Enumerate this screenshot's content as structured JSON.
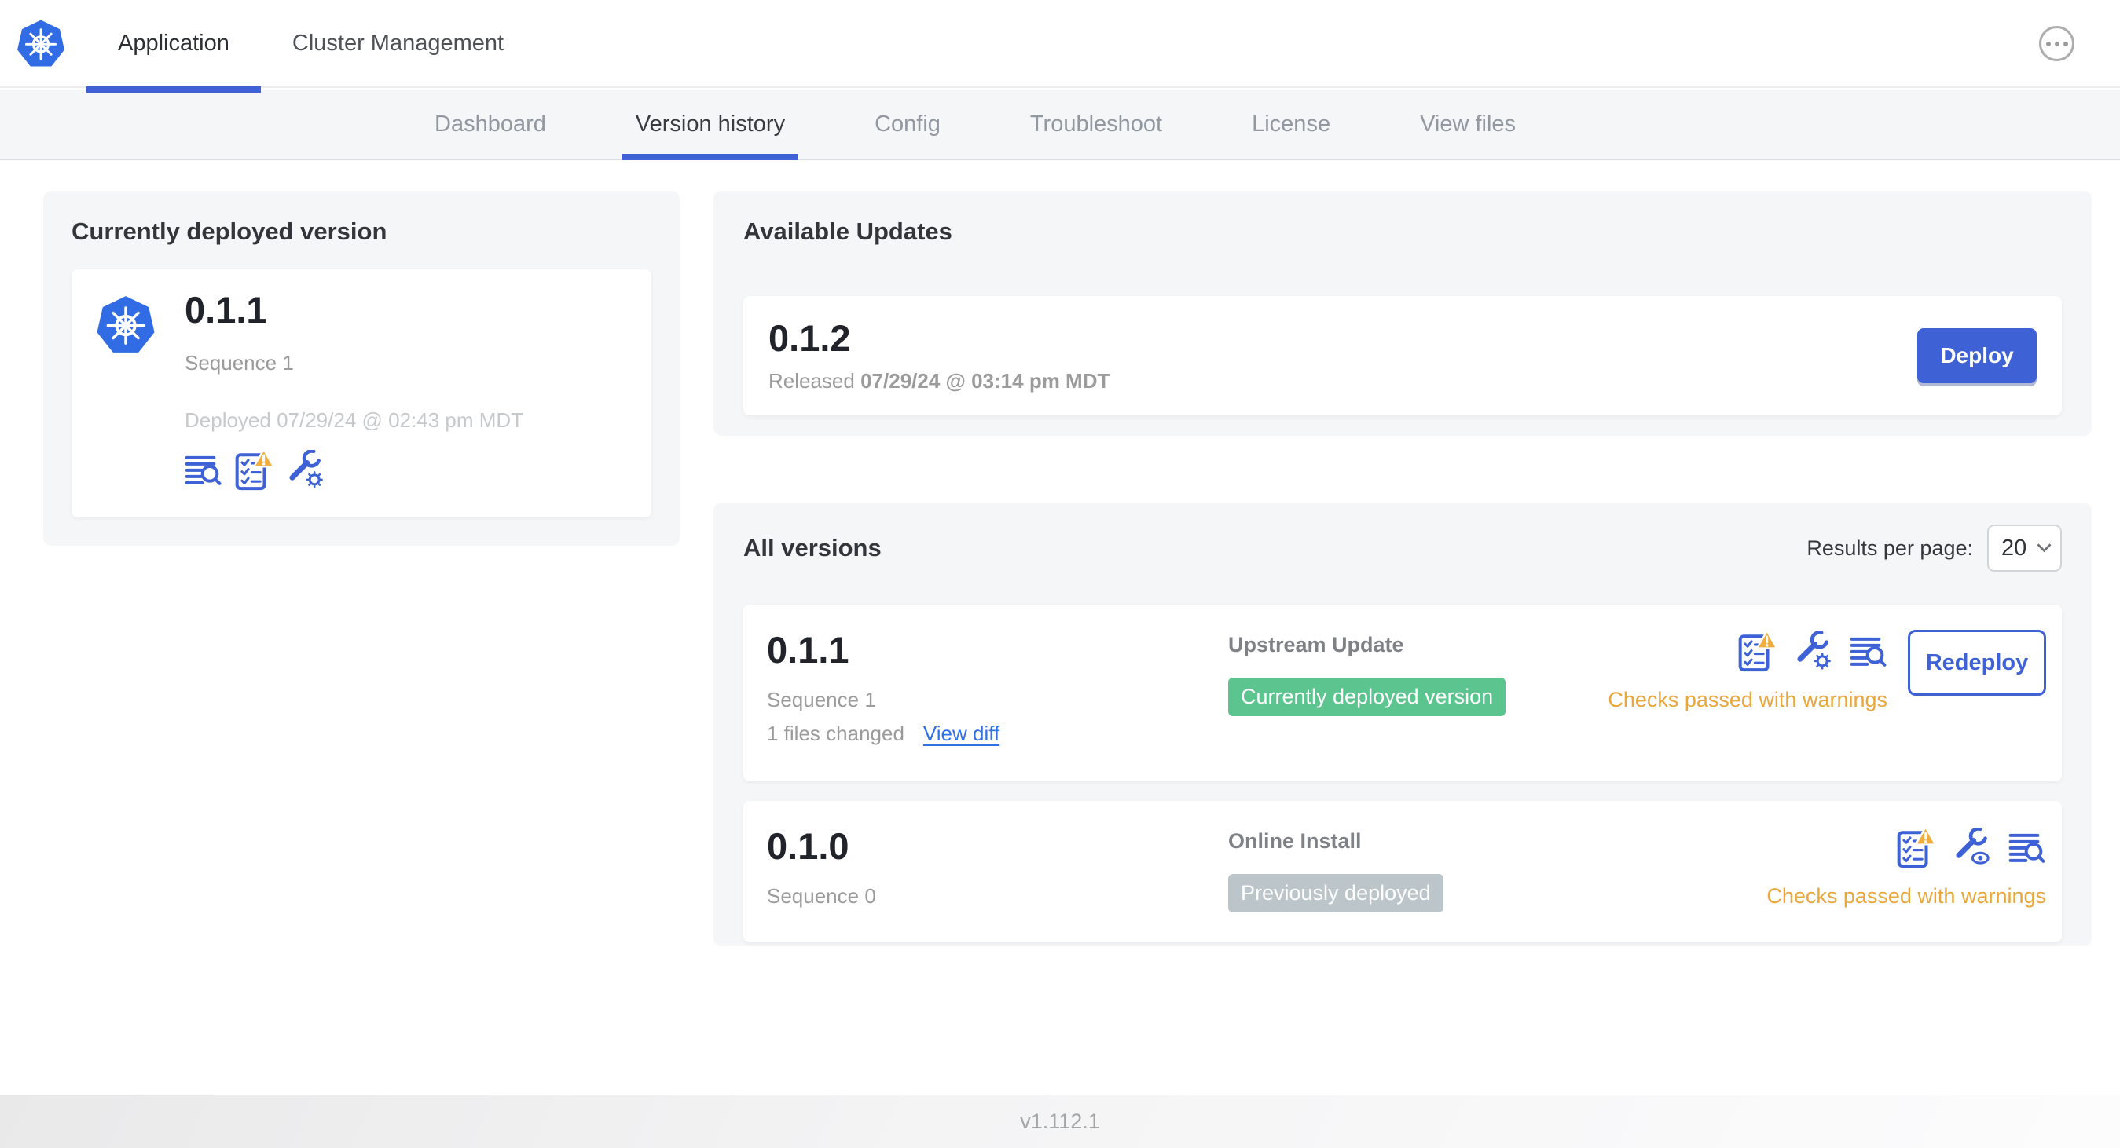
{
  "header": {
    "logo_icon": "kubernetes-logo",
    "tabs": [
      {
        "label": "Application",
        "active": true
      },
      {
        "label": "Cluster Management",
        "active": false
      }
    ],
    "menu_icon": "ellipsis-icon"
  },
  "subnav": {
    "tabs": [
      {
        "label": "Dashboard",
        "active": false
      },
      {
        "label": "Version history",
        "active": true
      },
      {
        "label": "Config",
        "active": false
      },
      {
        "label": "Troubleshoot",
        "active": false
      },
      {
        "label": "License",
        "active": false
      },
      {
        "label": "View files",
        "active": false
      }
    ]
  },
  "current_version": {
    "title": "Currently deployed version",
    "version": "0.1.1",
    "sequence": "Sequence 1",
    "deployed": "Deployed 07/29/24 @ 02:43 pm MDT",
    "icons": [
      "release-notes-icon",
      "preflight-checks-warning-icon",
      "edit-config-icon"
    ]
  },
  "available_updates": {
    "title": "Available Updates",
    "update": {
      "version": "0.1.2",
      "released_prefix": "Released",
      "released_date": "07/29/24 @ 03:14 pm MDT",
      "deploy_label": "Deploy"
    }
  },
  "all_versions": {
    "title": "All versions",
    "results_per_page_label": "Results per page:",
    "results_per_page_value": "20",
    "rows": [
      {
        "version": "0.1.1",
        "sequence": "Sequence 1",
        "files_changed": "1 files changed",
        "view_diff": "View diff",
        "source": "Upstream Update",
        "badge": "Currently deployed version",
        "badge_color": "#5cc48e",
        "icons": [
          "preflight-checks-warning-icon",
          "edit-config-icon",
          "release-notes-icon"
        ],
        "status": "Checks passed with warnings",
        "action": "Redeploy"
      },
      {
        "version": "0.1.0",
        "sequence": "Sequence 0",
        "source": "Online Install",
        "badge": "Previously deployed",
        "badge_color": "#bcc6ca",
        "icons": [
          "preflight-checks-warning-icon",
          "view-config-icon",
          "release-notes-icon"
        ],
        "status": "Checks passed with warnings"
      }
    ]
  },
  "footer": {
    "app_version": "v1.112.1"
  },
  "colors": {
    "primary_blue": "#3e62d6",
    "link_blue": "#3071e8",
    "kubernetes_blue": "#326ce5",
    "warning_orange": "#e9a63b",
    "warning_triangle": "#f0ac3d",
    "success_green": "#5cc48e",
    "badge_gray": "#bcc6ca",
    "card_bg": "#f4f6f8"
  }
}
